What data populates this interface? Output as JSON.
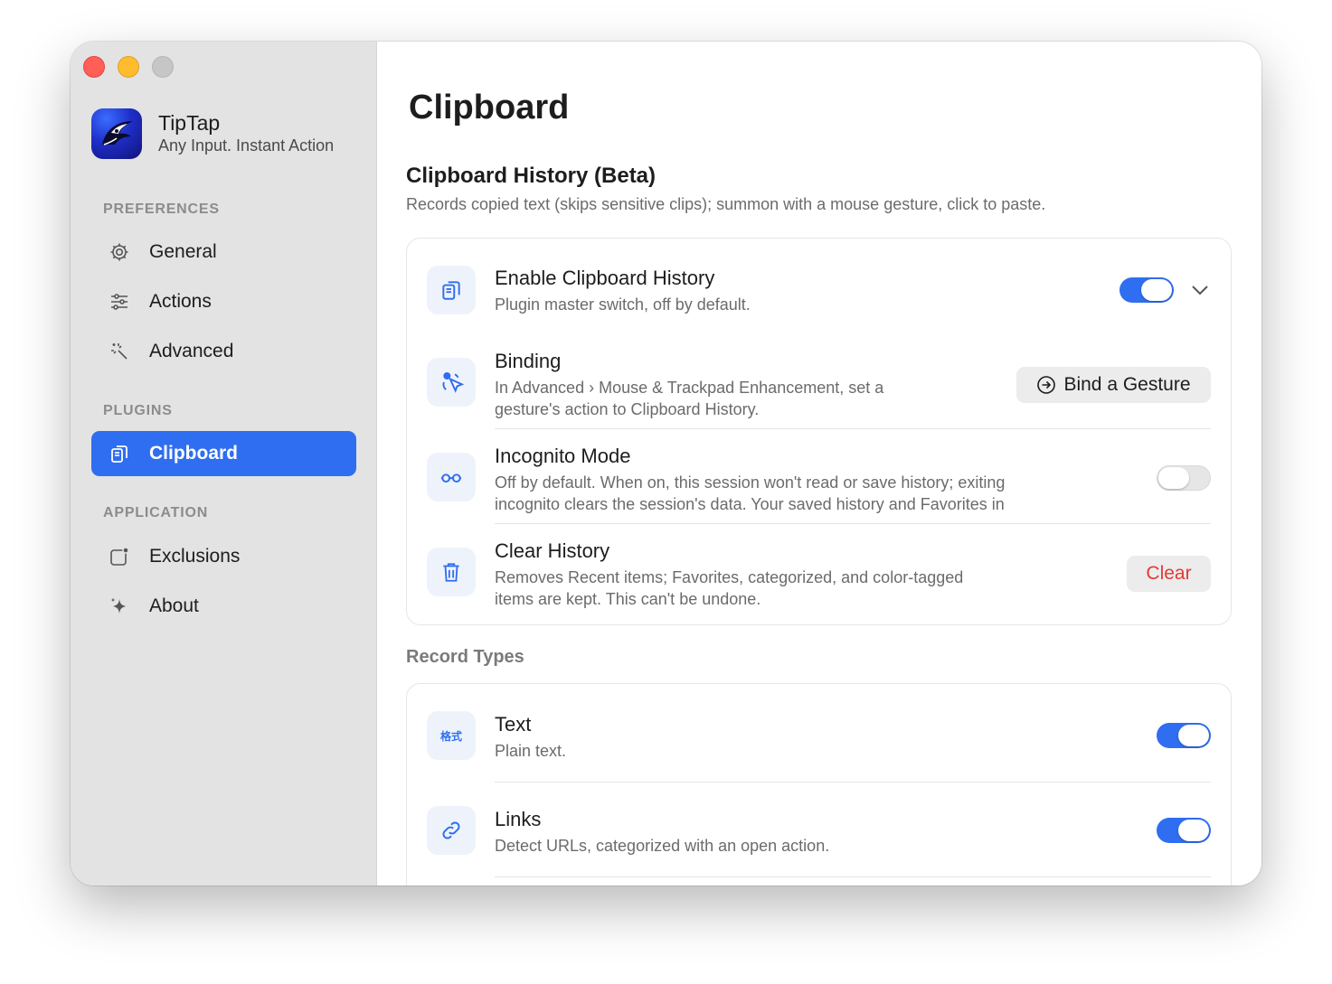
{
  "app": {
    "name": "TipTap",
    "tagline": "Any Input. Instant Action"
  },
  "sidebar": {
    "sections": {
      "preferences": "PREFERENCES",
      "plugins": "PLUGINS",
      "application": "APPLICATION"
    },
    "items": [
      {
        "label": "General",
        "icon": "gear-icon"
      },
      {
        "label": "Actions",
        "icon": "sliders-icon"
      },
      {
        "label": "Advanced",
        "icon": "magic-wand-icon"
      },
      {
        "label": "Clipboard",
        "icon": "clipboard-icon",
        "active": true
      },
      {
        "label": "Exclusions",
        "icon": "exclusion-window-icon"
      },
      {
        "label": "About",
        "icon": "sparkle-icon"
      }
    ]
  },
  "page": {
    "title": "Clipboard",
    "group_title": "Clipboard History (Beta)",
    "group_desc": "Records copied text (skips sensitive clips); summon with a mouse gesture, click to paste."
  },
  "settings": {
    "enable": {
      "title": "Enable Clipboard History",
      "desc": "Plugin master switch, off by default.",
      "on": true
    },
    "binding": {
      "title": "Binding",
      "desc1": "In Advanced › Mouse & Trackpad Enhancement, set a",
      "desc2": "gesture's action to Clipboard History.",
      "button": "Bind a Gesture"
    },
    "incognito": {
      "title": "Incognito Mode",
      "desc1": "Off by default. When on, this session won't read or save history; exiting",
      "desc2": "incognito clears the session's data. Your saved history and Favorites in",
      "on": false
    },
    "clear": {
      "title": "Clear History",
      "desc1": "Removes Recent items; Favorites, categorized, and color-tagged",
      "desc2": "items are kept. This can't be undone.",
      "button": "Clear"
    }
  },
  "record_types": {
    "heading": "Record Types",
    "text": {
      "title": "Text",
      "desc": "Plain text.",
      "icon_label": "格式",
      "on": true
    },
    "links": {
      "title": "Links",
      "desc": "Detect URLs, categorized with an open action.",
      "on": true
    }
  },
  "colors": {
    "accent": "#2f6ef0",
    "danger": "#e53935",
    "sidebar_bg": "#e3e3e3"
  }
}
